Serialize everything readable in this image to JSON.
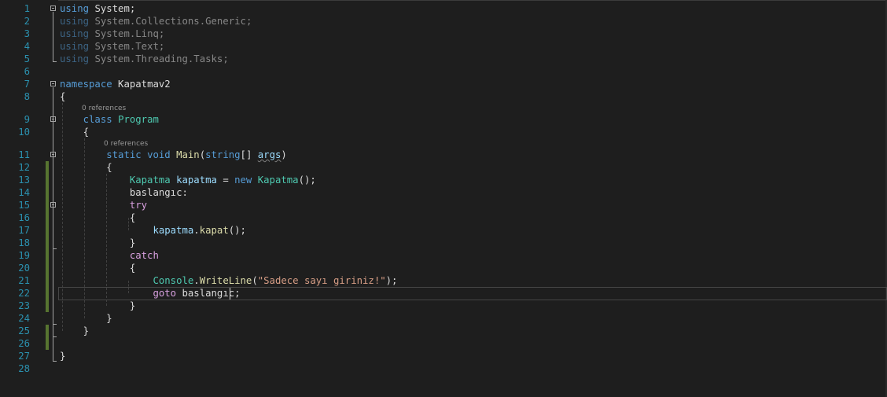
{
  "editor": {
    "line_numbers": [
      "1",
      "2",
      "3",
      "4",
      "5",
      "6",
      "7",
      "8",
      "9",
      "10",
      "11",
      "12",
      "13",
      "14",
      "15",
      "16",
      "17",
      "18",
      "19",
      "20",
      "21",
      "22",
      "23",
      "24",
      "25",
      "26",
      "27",
      "28"
    ],
    "code_lens": {
      "class_refs": "0 references",
      "method_refs": "0 references"
    },
    "tokens": {
      "kw_using": "using",
      "ns_system": "System",
      "ns_collections": "System.Collections.Generic",
      "ns_linq": "System.Linq",
      "ns_text": "System.Text",
      "ns_threading": "System.Threading.Tasks",
      "semicolon": ";",
      "kw_namespace": "namespace",
      "namespace_name": "Kapatmav2",
      "open_brace": "{",
      "close_brace": "}",
      "kw_class": "class",
      "class_name": "Program",
      "kw_static": "static",
      "kw_void": "void",
      "method_main": "Main",
      "paren_open": "(",
      "kw_string": "string",
      "brackets": "[]",
      "param_args": "args",
      "paren_close": ")",
      "type_kapatma": "Kapatma",
      "var_kapatma": "kapatma",
      "equals": "=",
      "kw_new": "new",
      "ctor_call": "();",
      "label_decl": "baslangıc:",
      "kw_try": "try",
      "dot": ".",
      "method_kapat": "kapat",
      "call_end": "();",
      "kw_catch": "catch",
      "type_console": "Console",
      "method_writeline": "WriteLine",
      "string_literal": "\"Sadece sayı giriniz!\"",
      "call_close": ");",
      "kw_goto": "goto",
      "label_ref": "baslangıc"
    }
  },
  "colors": {
    "background": "#1e1e1e",
    "line_number": "#2b91af",
    "keyword": "#569cd6",
    "control_keyword": "#d8a0df",
    "type": "#4ec9b0",
    "method": "#dcdcaa",
    "string": "#d69d85",
    "identifier": "#9cdcfe",
    "text": "#dcdcdc",
    "change_marker": "#577430"
  }
}
